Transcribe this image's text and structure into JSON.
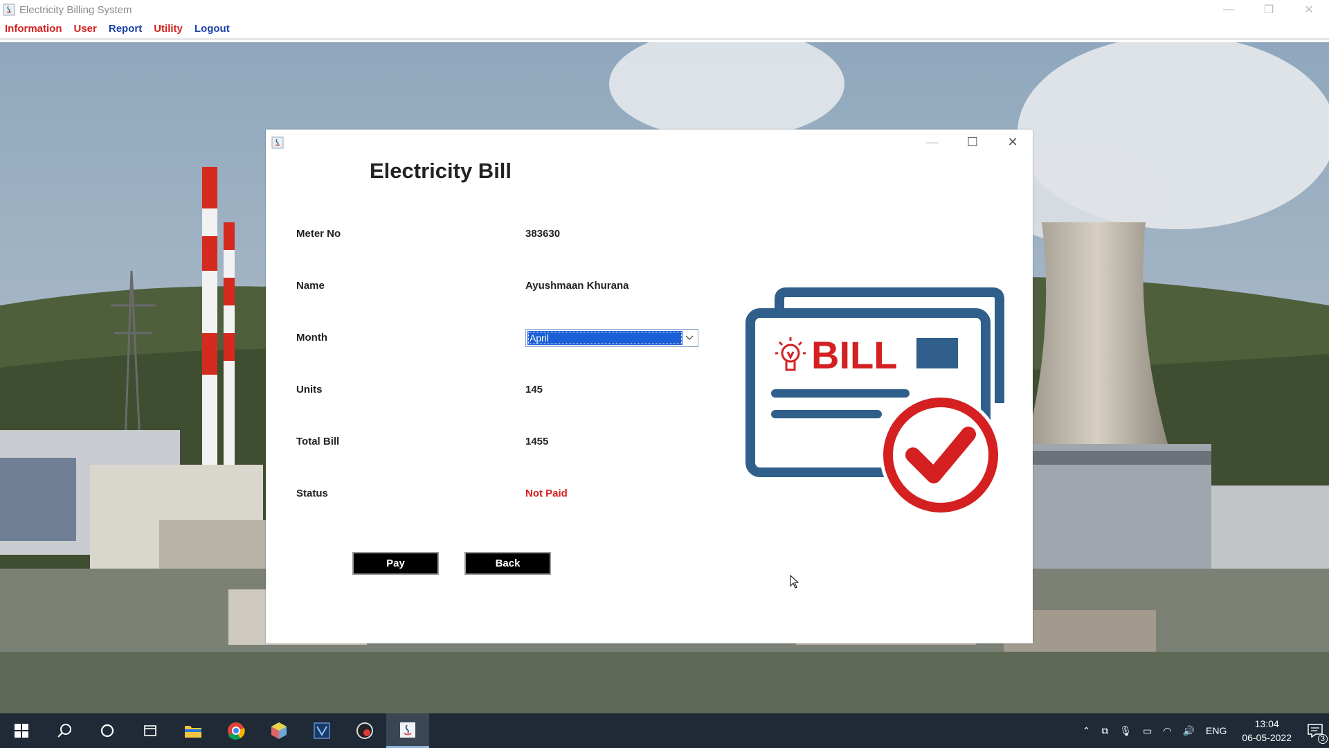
{
  "app": {
    "title": "Electricity Billing System",
    "menu": [
      {
        "label": "Information",
        "color": "#d42020"
      },
      {
        "label": "User",
        "color": "#d42020"
      },
      {
        "label": "Report",
        "color": "#1a3fa8"
      },
      {
        "label": "Utility",
        "color": "#d42020"
      },
      {
        "label": "Logout",
        "color": "#1a3fa8"
      }
    ]
  },
  "dialog": {
    "heading": "Electricity Bill",
    "fields": {
      "meter_label": "Meter No",
      "meter_value": "383630",
      "name_label": "Name",
      "name_value": "Ayushmaan Khurana",
      "month_label": "Month",
      "month_value": "April",
      "units_label": "Units",
      "units_value": "145",
      "total_label": "Total Bill",
      "total_value": "1455",
      "status_label": "Status",
      "status_value": "Not Paid"
    },
    "buttons": {
      "pay": "Pay",
      "back": "Back"
    },
    "graphic": {
      "text": "BILL",
      "icon": "bill-paid-check-icon"
    }
  },
  "taskbar": {
    "language": "ENG",
    "time": "13:04",
    "date": "06-05-2022",
    "notifications": "3"
  },
  "colors": {
    "accent_red": "#d42020",
    "bill_blue": "#2f5f8a",
    "selection_blue": "#1a5fd6",
    "taskbar": "#1f2a36"
  }
}
